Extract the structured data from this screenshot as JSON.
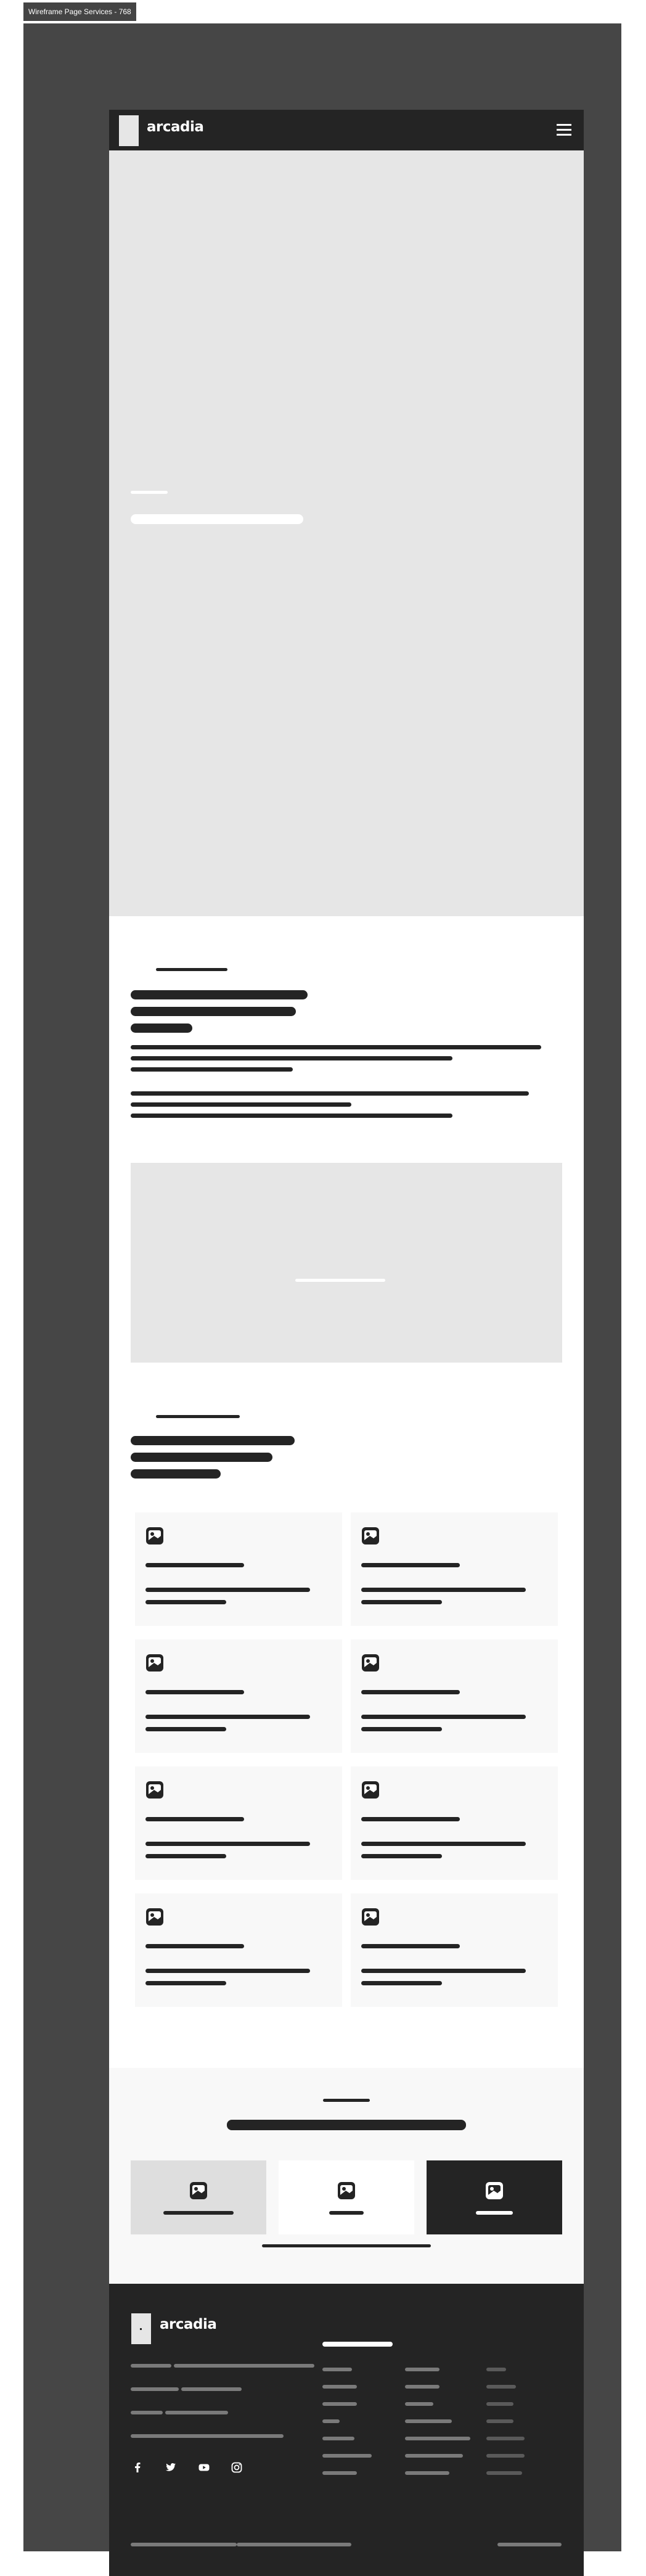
{
  "window": {
    "tag_label": "Wireframe Page Services - 768"
  },
  "header": {
    "logo_text": "arcadia"
  },
  "footer": {
    "logo_text": "arcadia"
  },
  "icons": {
    "hamburger": "menu-icon",
    "card_image": "image-placeholder-icon",
    "social": [
      "facebook-icon",
      "twitter-icon",
      "youtube-icon",
      "instagram-icon"
    ]
  },
  "colors": {
    "dark": "#242424",
    "frame": "#464646",
    "placeholder": "#e6e6e6",
    "card_bg": "#f8f8f8",
    "white": "#ffffff"
  }
}
